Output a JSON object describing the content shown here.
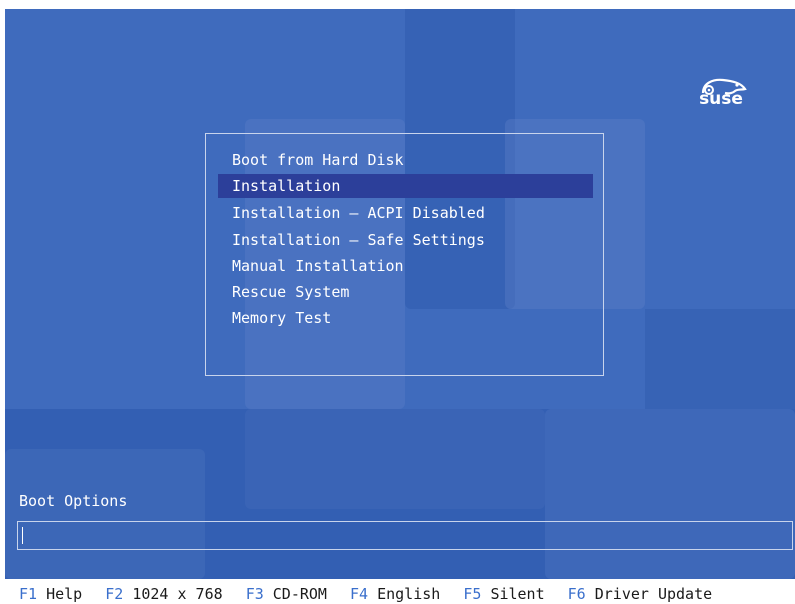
{
  "logo": {
    "text": "suse"
  },
  "menu": {
    "items": [
      {
        "label": "Boot from Hard Disk",
        "selected": false
      },
      {
        "label": "Installation",
        "selected": true
      },
      {
        "label": "Installation – ACPI Disabled",
        "selected": false
      },
      {
        "label": "Installation – Safe Settings",
        "selected": false
      },
      {
        "label": "Manual Installation",
        "selected": false
      },
      {
        "label": "Rescue System",
        "selected": false
      },
      {
        "label": "Memory Test",
        "selected": false
      }
    ]
  },
  "boot_options": {
    "label": "Boot Options",
    "value": ""
  },
  "function_keys": [
    {
      "key": "F1",
      "label": "Help"
    },
    {
      "key": "F2",
      "label": "1024 x 768"
    },
    {
      "key": "F3",
      "label": "CD-ROM"
    },
    {
      "key": "F4",
      "label": "English"
    },
    {
      "key": "F5",
      "label": "Silent"
    },
    {
      "key": "F6",
      "label": "Driver Update"
    }
  ],
  "colors": {
    "background": "#3f6bbd",
    "selection": "#2c3f9a",
    "fkey_accent": "#3a6fcc"
  }
}
